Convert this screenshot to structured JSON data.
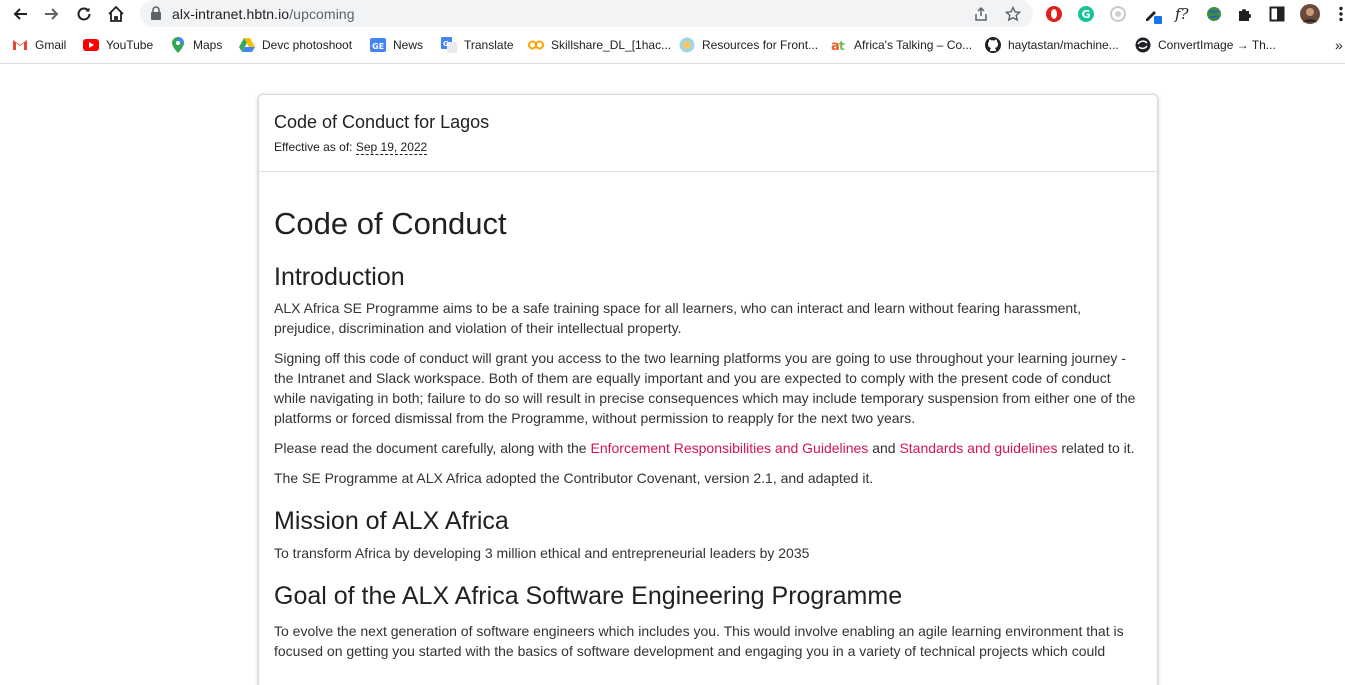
{
  "browser": {
    "url_host": "alx-intranet.hbtn.io",
    "url_path": "/upcoming",
    "bookmarks": [
      {
        "label": "Gmail",
        "icon": "gmail-icon"
      },
      {
        "label": "YouTube",
        "icon": "youtube-icon"
      },
      {
        "label": "Maps",
        "icon": "maps-icon"
      },
      {
        "label": "Devc photoshoot",
        "icon": "drive-icon"
      },
      {
        "label": "News",
        "icon": "news-icon"
      },
      {
        "label": "Translate",
        "icon": "translate-icon"
      },
      {
        "label": "Skillshare_DL_[1hac...",
        "icon": "skillshare-icon"
      },
      {
        "label": "Resources for Front...",
        "icon": "resources-icon"
      },
      {
        "label": "Africa's Talking – Co...",
        "icon": "africas-talking-icon"
      },
      {
        "label": "haytastan/machine...",
        "icon": "github-icon"
      },
      {
        "label": "ConvertImage → Th...",
        "icon": "convertimage-icon"
      }
    ],
    "more_bookmarks": "»"
  },
  "page": {
    "card_title": "Code of Conduct for Lagos",
    "effective_label": "Effective as of: ",
    "effective_date": "Sep 19, 2022",
    "heading": "Code of Conduct",
    "intro_heading": "Introduction",
    "intro_p1": "ALX Africa SE Programme aims to be a safe training space for all learners, who can interact and learn without fearing harassment, prejudice, discrimination and violation of their intellectual property.",
    "intro_p2": "Signing off this code of conduct will grant you access to the two learning platforms you are going to use throughout your learning journey - the Intranet and Slack workspace. Both of them are equally important and you are expected to comply with the present code of conduct while navigating in both; failure to do so will result in precise consequences which may include temporary suspension from either one of the platforms or forced dismissal from the Programme, without permission to reapply for the next two years.",
    "intro_p3_before": "Please read the document carefully, along with the ",
    "intro_p3_link1": "Enforcement Responsibilities and Guidelines",
    "intro_p3_middle": " and ",
    "intro_p3_link2": "Standards and guidelines",
    "intro_p3_after": " related to it.",
    "intro_p4": "The SE Programme at ALX Africa adopted the Contributor Covenant, version 2.1, and adapted it.",
    "mission_heading": "Mission of ALX Africa",
    "mission_p": "To transform Africa by developing 3 million ethical and entrepreneurial leaders by 2035",
    "goal_heading": "Goal of the ALX Africa Software Engineering Programme",
    "goal_p": "To evolve the next generation of software engineers which includes you. This would involve enabling an agile learning environment that is focused on getting you started with the basics of software development and engaging you in a variety of technical projects which could",
    "link_color": "#d3164f"
  }
}
